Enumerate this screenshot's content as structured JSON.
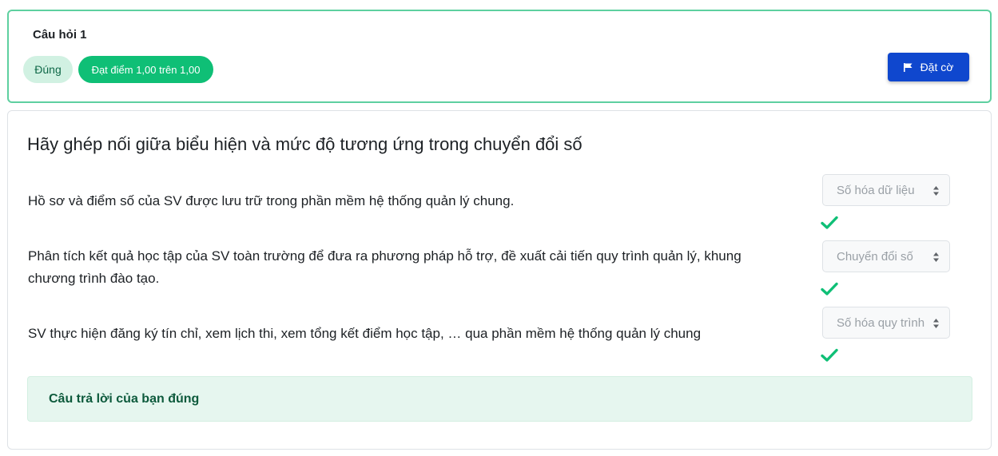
{
  "info": {
    "question_label": "Câu hỏi 1",
    "status_badge": "Đúng",
    "score_badge": "Đạt điểm 1,00 trên 1,00",
    "flag_button": "Đặt cờ"
  },
  "question": {
    "prompt": "Hãy ghép nối giữa biểu hiện và mức độ tương ứng trong chuyển đổi số",
    "rows": [
      {
        "text_lines": [
          "Hồ sơ và điểm số của SV được lưu trữ trong phần mềm hệ thống quản lý chung."
        ],
        "selected": "Số hóa dữ liệu",
        "icon": "check-icon"
      },
      {
        "text_lines": [
          "Phân tích kết quả học tập của SV toàn trường để đưa ra phương pháp hỗ trợ, đề xuất cải tiến quy trình quản lý, khung",
          "chương trình đào tạo."
        ],
        "selected": "Chuyển đổi số",
        "icon": "check-icon"
      },
      {
        "text_lines": [
          "SV thực hiện đăng ký tín chỉ, xem lịch thi, xem tổng kết điểm học tập, … qua phần mềm hệ thống quản lý chung"
        ],
        "selected": "Số hóa quy trình",
        "icon": "check-icon"
      }
    ]
  },
  "feedback": {
    "text": "Câu trả lời của bạn đúng"
  },
  "colors": {
    "success": "#0fbf76",
    "primary": "#0f47ce",
    "card_border": "#5ed0a0",
    "feedback_bg": "#e6f6ef"
  }
}
